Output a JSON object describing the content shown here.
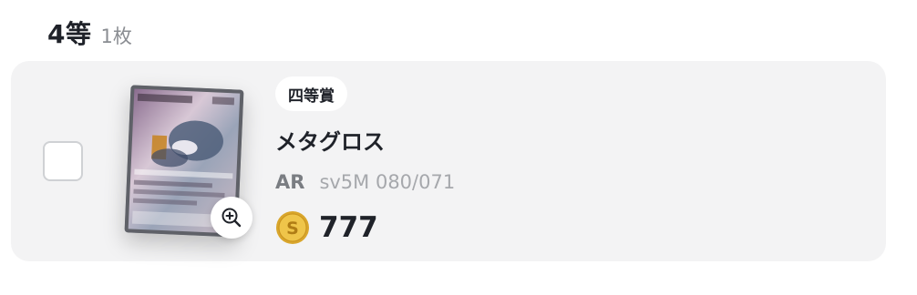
{
  "header": {
    "tier_title": "4等",
    "count": "1枚"
  },
  "card": {
    "badge": "四等賞",
    "name": "メタグロス",
    "rarity": "AR",
    "code": "sv5M 080/071",
    "price": "777",
    "currency_icon": "gold-coin-icon",
    "zoom_icon": "zoom-in-icon",
    "colors": {
      "row_background": "#f3f3f4",
      "coin": "#e2b53a"
    }
  }
}
